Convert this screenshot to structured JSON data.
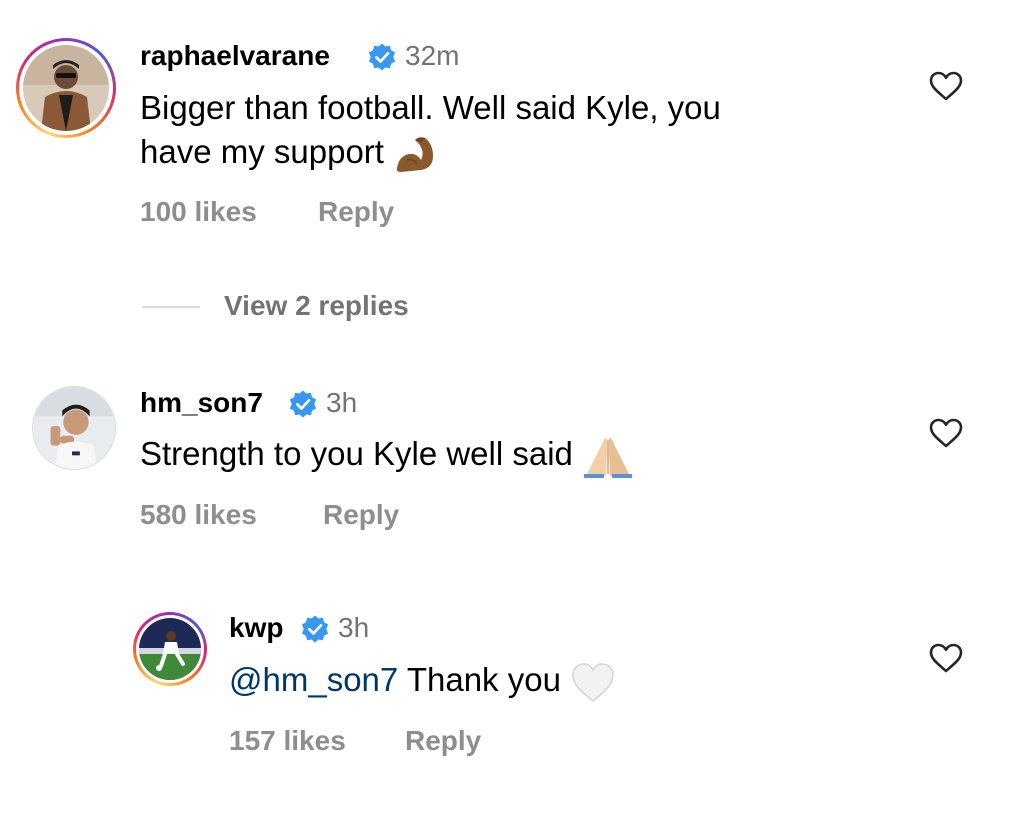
{
  "comments": [
    {
      "username": "raphaelvarane",
      "time": "32m",
      "text_line1": "Bigger than football. Well said Kyle, you",
      "text_line2": "have my support",
      "emoji": "flexed-biceps",
      "likes": "100 likes",
      "reply_label": "Reply",
      "verified": true
    },
    {
      "username": "hm_son7",
      "time": "3h",
      "text": "Strength to you Kyle well said",
      "emoji": "folded-hands",
      "likes": "580 likes",
      "reply_label": "Reply",
      "verified": true
    }
  ],
  "view_replies_label": "View 2 replies",
  "reply": {
    "username": "kwp",
    "time": "3h",
    "mention": "@hm_son7",
    "text": "Thank you",
    "emoji": "white-heart",
    "likes": "157 likes",
    "reply_label": "Reply",
    "verified": true
  },
  "colors": {
    "verified_badge": "#3897f0",
    "meta_text": "#8e8e8e",
    "time_text": "#737373",
    "mention": "#00376b",
    "divider": "#dbdbdb"
  },
  "icons": {
    "like": "heart-outline-icon",
    "verified": "verified-badge-icon"
  }
}
